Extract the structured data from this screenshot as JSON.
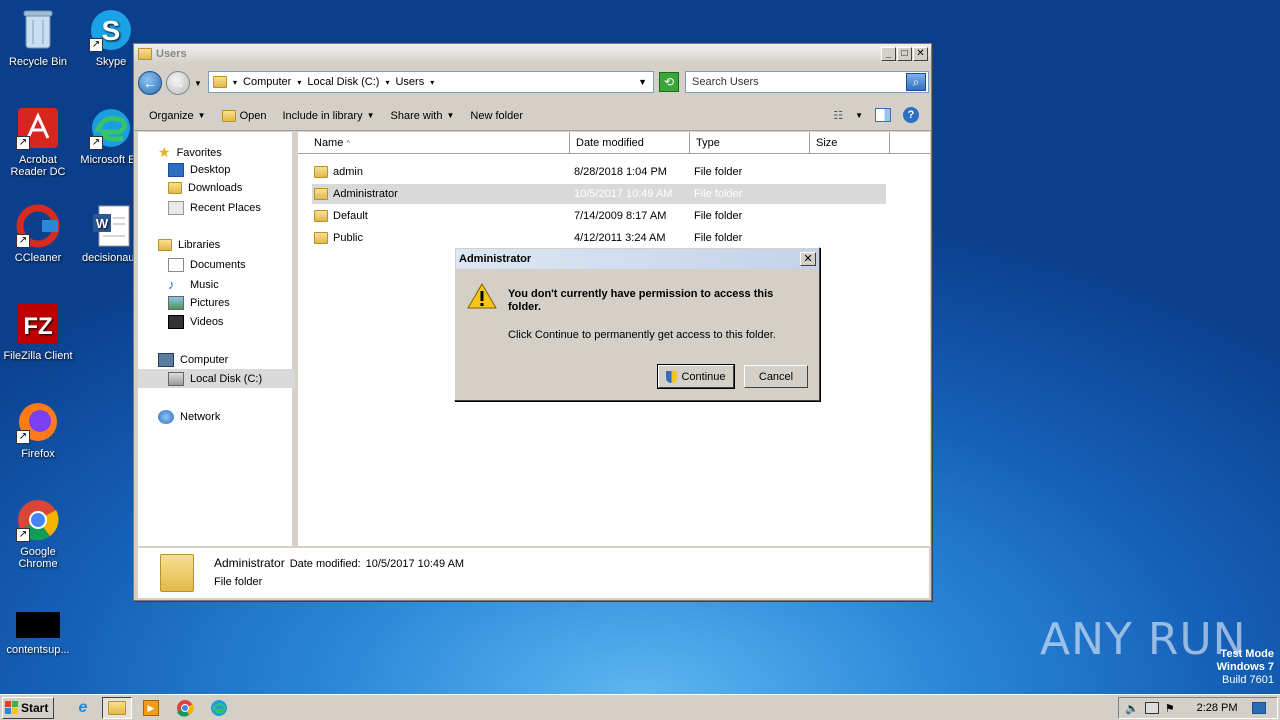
{
  "desktop": {
    "icons": [
      {
        "label": "Recycle Bin"
      },
      {
        "label": "Skype"
      },
      {
        "label": "Acrobat Reader DC"
      },
      {
        "label": "Microsoft Ed"
      },
      {
        "label": "CCleaner"
      },
      {
        "label": "decisionaus"
      },
      {
        "label": "FileZilla Client"
      },
      {
        "label": "Firefox"
      },
      {
        "label": "Google Chrome"
      },
      {
        "label": "contentsup..."
      }
    ],
    "watermark": "ANY RUN",
    "test_mode": {
      "line1": "Test Mode",
      "line2": "Windows 7",
      "line3": "Build 7601"
    }
  },
  "explorer": {
    "title": "Users",
    "breadcrumb": [
      "Computer",
      "Local Disk (C:)",
      "Users"
    ],
    "search_placeholder": "Search Users",
    "toolbar": {
      "organize": "Organize",
      "open": "Open",
      "include_in_library": "Include in library",
      "share_with": "Share with",
      "new_folder": "New folder"
    },
    "nav": {
      "favorites": "Favorites",
      "desktop": "Desktop",
      "downloads": "Downloads",
      "recent_places": "Recent Places",
      "libraries": "Libraries",
      "documents": "Documents",
      "music": "Music",
      "pictures": "Pictures",
      "videos": "Videos",
      "computer": "Computer",
      "local_disk": "Local Disk (C:)",
      "network": "Network"
    },
    "columns": [
      "Name",
      "Date modified",
      "Type",
      "Size"
    ],
    "rows": [
      {
        "name": "admin",
        "date": "8/28/2018 1:04 PM",
        "type": "File folder"
      },
      {
        "name": "Administrator",
        "date": "10/5/2017 10:49 AM",
        "type": "File folder"
      },
      {
        "name": "Default",
        "date": "7/14/2009 8:17 AM",
        "type": "File folder"
      },
      {
        "name": "Public",
        "date": "4/12/2011 3:24 AM",
        "type": "File folder"
      }
    ],
    "details": {
      "name": "Administrator",
      "date_label": "Date modified:",
      "date_value": "10/5/2017 10:49 AM",
      "type": "File folder"
    }
  },
  "dialog": {
    "title": "Administrator",
    "message": "You don't currently have permission to access this folder.",
    "sub": "Click Continue to permanently get access to this folder.",
    "continue": "Continue",
    "cancel": "Cancel"
  },
  "taskbar": {
    "start": "Start",
    "clock": "2:28 PM"
  }
}
